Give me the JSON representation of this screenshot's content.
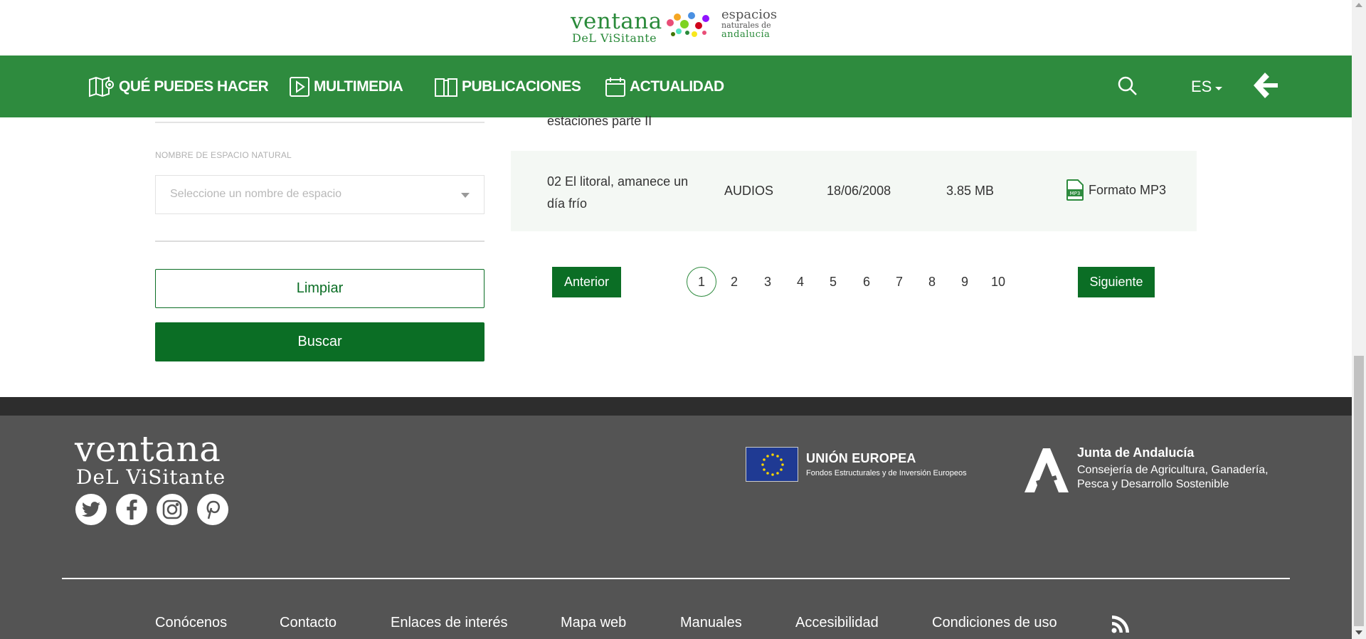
{
  "header": {
    "logo": {
      "word1": "ventana",
      "word2": "DeL ViSitante",
      "word3": "espacios",
      "word4": "naturales de",
      "word5": "andalucía"
    }
  },
  "nav": {
    "items": [
      {
        "label": "QUÉ PUEDES HACER",
        "icon": "map-pin-icon"
      },
      {
        "label": "MULTIMEDIA",
        "icon": "play-icon"
      },
      {
        "label": "PUBLICACIONES",
        "icon": "book-icon"
      },
      {
        "label": "ACTUALIDAD",
        "icon": "calendar-icon"
      }
    ],
    "lang": "ES"
  },
  "filters": {
    "space_label": "NOMBRE DE ESPACIO NATURAL",
    "space_placeholder": "Seleccione un nombre de espacio",
    "clear_label": "Limpiar",
    "search_label": "Buscar"
  },
  "results": {
    "prev_title_tail": "estaciones parte II",
    "row": {
      "title": "02 El litoral, amanece un día frío",
      "type": "AUDIOS",
      "date": "18/06/2008",
      "size": "3.85 MB",
      "format": "Formato MP3"
    }
  },
  "pagination": {
    "prev": "Anterior",
    "next": "Siguiente",
    "pages": [
      "1",
      "2",
      "3",
      "4",
      "5",
      "6",
      "7",
      "8",
      "9",
      "10"
    ],
    "current": "1"
  },
  "footer": {
    "logo_word1": "ventana",
    "logo_word2": "DeL ViSitante",
    "social": [
      "twitter-icon",
      "facebook-icon",
      "instagram-icon",
      "pinterest-icon"
    ],
    "eu_title": "UNIÓN EUROPEA",
    "eu_sub": "Fondos Estructurales y de Inversión Europeos",
    "junta_title": "Junta de Andalucía",
    "junta_sub1": "Consejería de Agricultura, Ganadería,",
    "junta_sub2": "Pesca y Desarrollo Sostenible",
    "links": [
      "Conócenos",
      "Contacto",
      "Enlaces de interés",
      "Mapa web",
      "Manuales",
      "Accesibilidad",
      "Condiciones de uso"
    ]
  },
  "colors": {
    "brand_green": "#2e8b3e",
    "dark_green": "#0b6e25",
    "footer_gray": "#545454"
  }
}
